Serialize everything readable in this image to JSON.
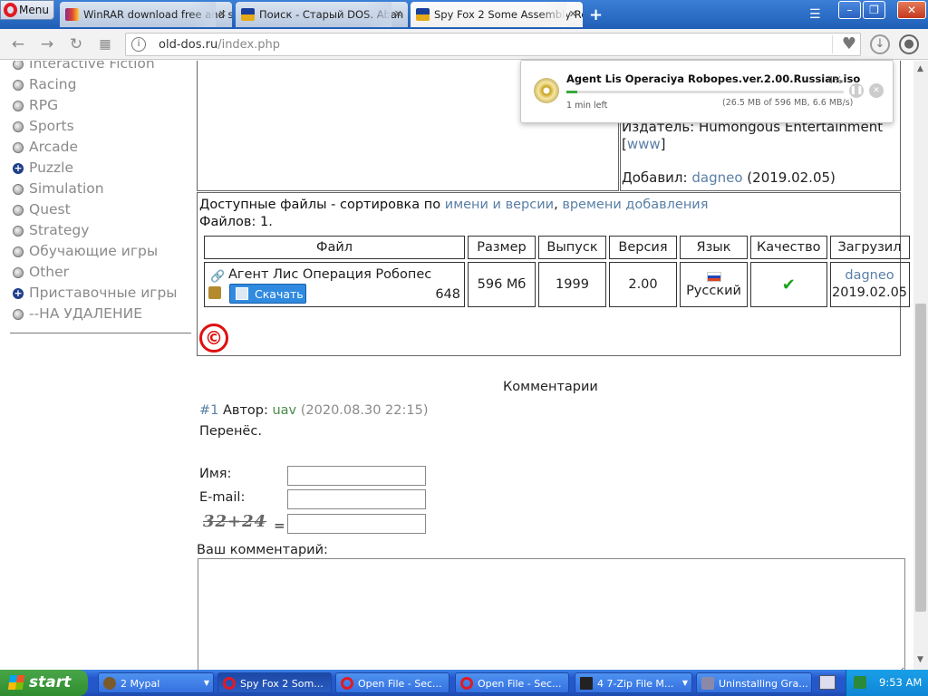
{
  "browser": {
    "menu_label": "Menu",
    "tabs": [
      {
        "title": "WinRAR download free and s"
      },
      {
        "title": "Поиск - Старый DOS. Aban"
      },
      {
        "title": "Spy Fox 2 Some Assembly Re"
      }
    ],
    "url_host": "old-dos.ru",
    "url_path": "/index.php"
  },
  "sidebar": {
    "items": [
      {
        "label": "Interactive Fiction",
        "expandable": false
      },
      {
        "label": "Racing",
        "expandable": false
      },
      {
        "label": "RPG",
        "expandable": false
      },
      {
        "label": "Sports",
        "expandable": false
      },
      {
        "label": "Arcade",
        "expandable": false
      },
      {
        "label": "Puzzle",
        "expandable": true
      },
      {
        "label": "Simulation",
        "expandable": false
      },
      {
        "label": "Quest",
        "expandable": false
      },
      {
        "label": "Strategy",
        "expandable": false
      },
      {
        "label": "Обучающие игры",
        "expandable": false
      },
      {
        "label": "Other",
        "expandable": false
      },
      {
        "label": "Приставочные игры",
        "expandable": true
      },
      {
        "label": "--НА УДАЛЕНИЕ",
        "expandable": false
      }
    ]
  },
  "game_info": {
    "publisher_label": "Издатель:",
    "publisher": "Humongous Entertainment",
    "www_open": "[",
    "www": "www",
    "www_close": "]",
    "added_label": "Добавил:",
    "added_by": "dagneo",
    "added_date": "(2019.02.05)"
  },
  "files": {
    "heading_prefix": "Доступные файлы - сортировка по",
    "sort_by_name": "имени и версии",
    "comma": ",",
    "sort_by_time": "времени добавления",
    "count_label": "Файлов: 1.",
    "columns": [
      "Файл",
      "Размер",
      "Выпуск",
      "Версия",
      "Язык",
      "Качество",
      "Загрузил"
    ],
    "row": {
      "name": "Агент Лис Операция Робопес",
      "download_label": "Скачать",
      "downloads": "648",
      "size": "596 Мб",
      "year": "1999",
      "version": "2.00",
      "language": "Русский",
      "quality_icon": "check-icon",
      "uploader": "dagneo",
      "upload_date": "2019.02.05"
    },
    "copyright_symbol": "©"
  },
  "comments": {
    "title": "Комментарии",
    "items": [
      {
        "num": "#1",
        "author_label": "Автор:",
        "author": "uav",
        "date": "(2020.08.30 22:15)",
        "text": "Перенёс."
      }
    ]
  },
  "form": {
    "name_label": "Имя:",
    "email_label": "E-mail:",
    "captcha_text": "32+24",
    "equals": "=",
    "comment_label": "Ваш комментарий:"
  },
  "download_popup": {
    "filename": "Agent Lis Operaciya Robopes.ver.2.00.Russian.iso",
    "percent": "4%",
    "progress_value": 0.04,
    "size_text": "(26.5 MB of 596 MB, 6.6 MB/s)",
    "time_left": "1 min left"
  },
  "taskbar": {
    "start_label": "start",
    "items": [
      {
        "label": "2 Mypal"
      },
      {
        "label": "Spy Fox 2 Som..."
      },
      {
        "label": "Open File - Sec..."
      },
      {
        "label": "Open File - Sec..."
      },
      {
        "label": "4 7-Zip File M..."
      },
      {
        "label": "Uninstalling Gra..."
      }
    ],
    "clock": "9:53 AM"
  }
}
